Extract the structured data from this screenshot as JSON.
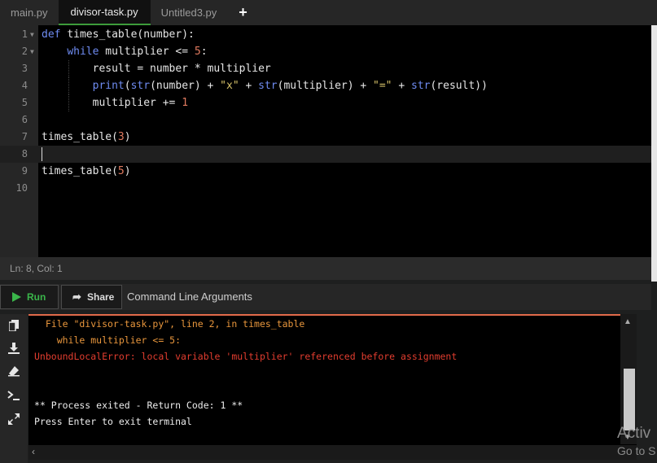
{
  "tabs": [
    {
      "label": "main.py"
    },
    {
      "label": "divisor-task.py"
    },
    {
      "label": "Untitled3.py"
    }
  ],
  "tab_add_label": "+",
  "editor": {
    "line_numbers": [
      "1",
      "2",
      "3",
      "4",
      "5",
      "6",
      "7",
      "8",
      "9",
      "10"
    ],
    "active_line": 8
  },
  "status": "Ln: 8,  Col: 1",
  "toolbar": {
    "run_label": "Run",
    "share_label": "Share",
    "args_label": "Command Line Arguments"
  },
  "terminal": {
    "lines": [
      "  File \"divisor-task.py\", line 2, in times_table",
      "    while multiplier <= 5:",
      "UnboundLocalError: local variable 'multiplier' referenced before assignment",
      "",
      "",
      "** Process exited - Return Code: 1 **",
      "Press Enter to exit terminal"
    ]
  },
  "side_icons": [
    "copy-icon",
    "download-icon",
    "eraser-icon",
    "terminal-icon",
    "expand-icon"
  ],
  "watermark": {
    "line1": "Activ",
    "line2": "Go to S"
  },
  "colors": {
    "accent_green": "#3ab54a",
    "error_red": "#e23d2f",
    "trace_orange": "#e8963c",
    "keyword_blue": "#6f8cf2"
  }
}
